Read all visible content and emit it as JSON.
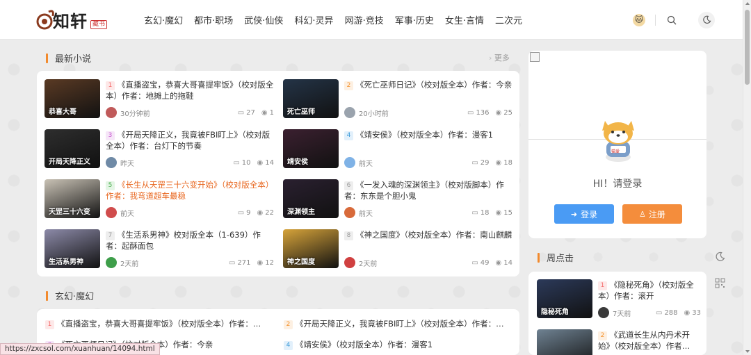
{
  "header": {
    "logo_text": "知轩",
    "logo_sub": "藏书",
    "nav": [
      "玄幻·魔幻",
      "都市·职场",
      "武侠·仙侠",
      "科幻·灵异",
      "网游·竞技",
      "军事·历史",
      "女生·言情",
      "二次元"
    ]
  },
  "latest": {
    "title": "最新小说",
    "more": "更多",
    "books": [
      {
        "rank": "1",
        "title": "《直播盗宝，恭喜大哥喜提牢饭》（校对版全本）作者：地摊上的拖鞋",
        "time": "30分钟前",
        "comments": "27",
        "views": "1",
        "cover_text": "恭喜大哥",
        "cover_color": "#5a3a24",
        "avatar_color": "#c05a5a",
        "rank_color": "#f56c6c",
        "rank_bg": "#fde8e8",
        "highlight": false
      },
      {
        "rank": "2",
        "title": "《死亡巫师日记》（校对版全本）作者：今亲",
        "time": "20小时前",
        "comments": "136",
        "views": "25",
        "cover_text": "死亡巫师",
        "cover_color": "#243447",
        "avatar_color": "#9aa3ad",
        "rank_color": "#f5922d",
        "rank_bg": "#fdf0e2",
        "highlight": false
      },
      {
        "rank": "3",
        "title": "《开局天降正义，我竟被FBI盯上》（校对版全本）作者：台灯下的节奏",
        "time": "昨天",
        "comments": "10",
        "views": "14",
        "cover_text": "开局天降正义",
        "cover_color": "#2e2e2e",
        "avatar_color": "#6f8aa6",
        "rank_color": "#c85ad0",
        "rank_bg": "#f6e6f8",
        "highlight": false
      },
      {
        "rank": "4",
        "title": "《靖安侯》（校对版全本）作者：漫客1",
        "time": "前天",
        "comments": "29",
        "views": "18",
        "cover_text": "靖安侯",
        "cover_color": "#3b2030",
        "avatar_color": "#7fb2e6",
        "rank_color": "#3b9bd9",
        "rank_bg": "#e2f0fb",
        "highlight": false
      },
      {
        "rank": "5",
        "title": "《长生从天罡三十六变开始》（校对版全本）作者：我弯道超车最稳",
        "time": "前天",
        "comments": "9",
        "views": "22",
        "cover_text": "天罡三十六变",
        "cover_color": "#c9c2b5",
        "avatar_color": "#d04c4c",
        "rank_color": "#4caf50",
        "rank_bg": "#e4f5e5",
        "highlight": true
      },
      {
        "rank": "6",
        "title": "《一发入魂的深渊领主》（校对版脚本）作者：东东是个胆小鬼",
        "time": "前天",
        "comments": "18",
        "views": "15",
        "cover_text": "深渊领主",
        "cover_color": "#2a2030",
        "avatar_color": "#d86a3a",
        "rank_color": "#999999",
        "rank_bg": "#eeeeee",
        "highlight": false
      },
      {
        "rank": "7",
        "title": "《生活系男神》校对版全本（1-639）作者：起酥面包",
        "time": "2天前",
        "comments": "271",
        "views": "12",
        "cover_text": "生活系男神",
        "cover_color": "#8c8aa8",
        "avatar_color": "#3e9e4a",
        "rank_color": "#999999",
        "rank_bg": "#eeeeee",
        "highlight": false
      },
      {
        "rank": "8",
        "title": "《神之国度》（校对版全本）作者：南山麒麟",
        "time": "2天前",
        "comments": "49",
        "views": "14",
        "cover_text": "神之国度",
        "cover_color": "#d6a33a",
        "avatar_color": "#d04040",
        "rank_color": "#999999",
        "rank_bg": "#eeeeee",
        "highlight": false
      }
    ]
  },
  "xuanhuan": {
    "title": "玄幻·魔幻",
    "items": [
      {
        "rank": "1",
        "text": "《直播盗宝，恭喜大哥喜提牢饭》（校对版全本）作者：地摊上的拖鞋",
        "rank_color": "#f56c6c",
        "rank_bg": "#fde8e8"
      },
      {
        "rank": "2",
        "text": "《开局天降正义，我竟被FBI盯上》（校对版全本）作者：台灯下的节奏",
        "rank_color": "#f5922d",
        "rank_bg": "#fdf0e2"
      },
      {
        "rank": "3",
        "text": "《死亡巫师日记》（校对版全本）作者：今亲",
        "rank_color": "#c85ad0",
        "rank_bg": "#f6e6f8"
      },
      {
        "rank": "4",
        "text": "《靖安侯》（校对版全本）作者：漫客1",
        "rank_color": "#3b9bd9",
        "rank_bg": "#e2f0fb"
      }
    ]
  },
  "login": {
    "greeting": "HI！请登录",
    "login_label": "登录",
    "register_label": "注册",
    "mascot_badge": "猫爱"
  },
  "weekly": {
    "title": "周点击",
    "books": [
      {
        "rank": "1",
        "title": "《隐秘死角》（校对版全本）作者：滚开",
        "time": "7天前",
        "comments": "288",
        "views": "33",
        "cover_text": "隐秘死角",
        "cover_color": "#2c3a5a",
        "avatar_color": "#3a3a3a",
        "rank_color": "#f56c6c",
        "rank_bg": "#fde8e8"
      },
      {
        "rank": "2",
        "title": "《武道长生从内丹术开始》（校对版全本）作者…",
        "time": "",
        "comments": "",
        "views": "",
        "cover_text": "",
        "cover_color": "#6f8292",
        "avatar_color": "#888888",
        "rank_color": "#f5922d",
        "rank_bg": "#fdf0e2"
      }
    ]
  },
  "status_url": "https://zxcsol.com/xuanhuan/14094.html",
  "colors": {
    "accent": "#f28a2d",
    "login_btn": "#4a9bf4",
    "register_btn": "#f48d3c"
  }
}
